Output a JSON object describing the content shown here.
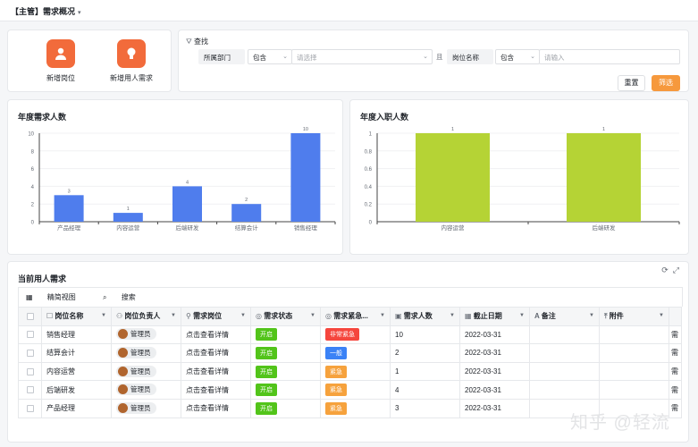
{
  "header": {
    "title": "【主管】需求概况",
    "caret": "▾"
  },
  "actions": [
    {
      "label": "新增岗位",
      "icon": "person-icon"
    },
    {
      "label": "新增用人需求",
      "icon": "lightbulb-icon"
    }
  ],
  "filter": {
    "title": "查找",
    "field1": "所属部门",
    "op1": "包含",
    "ph1": "请选择",
    "conj": "且",
    "field2": "岗位名称",
    "op2": "包含",
    "ph2": "请输入",
    "reset": "重置",
    "submit": "筛选"
  },
  "chart_data": [
    {
      "type": "bar",
      "title": "年度需求人数",
      "categories": [
        "产品经理",
        "内容运营",
        "后端研发",
        "结算会计",
        "销售经理"
      ],
      "values": [
        3,
        1,
        4,
        2,
        10
      ],
      "ylim": [
        0,
        10
      ],
      "yticks": [
        0,
        2,
        4,
        6,
        8,
        10
      ],
      "color": "#4f7ded"
    },
    {
      "type": "bar",
      "title": "年度入职人数",
      "categories": [
        "内容运营",
        "后端研发"
      ],
      "values": [
        1,
        1
      ],
      "ylim": [
        0,
        1
      ],
      "yticks": [
        "0",
        "0.2",
        "0.4",
        "0.6",
        "0.8",
        "1"
      ],
      "color": "#b5d335"
    }
  ],
  "table": {
    "title": "当前用人需求",
    "toolbar": {
      "view": "精简视图",
      "search": "搜索"
    },
    "columns": [
      "岗位名称",
      "岗位负责人",
      "需求岗位",
      "需求状态",
      "需求紧急...",
      "需求人数",
      "截止日期",
      "备注",
      "附件"
    ],
    "rows": [
      {
        "name": "销售经理",
        "owner": "管理员",
        "link": "点击查看详情",
        "status": "开启",
        "urgency": "非常紧急",
        "count": "10",
        "date": "2022-03-31"
      },
      {
        "name": "结算会计",
        "owner": "管理员",
        "link": "点击查看详情",
        "status": "开启",
        "urgency": "一般",
        "count": "2",
        "date": "2022-03-31"
      },
      {
        "name": "内容运营",
        "owner": "管理员",
        "link": "点击查看详情",
        "status": "开启",
        "urgency": "紧急",
        "count": "1",
        "date": "2022-03-31"
      },
      {
        "name": "后端研发",
        "owner": "管理员",
        "link": "点击查看详情",
        "status": "开启",
        "urgency": "紧急",
        "count": "4",
        "date": "2022-03-31"
      },
      {
        "name": "产品经理",
        "owner": "管理员",
        "link": "点击查看详情",
        "status": "开启",
        "urgency": "紧急",
        "count": "3",
        "date": "2022-03-31"
      }
    ],
    "overflow_col": "需"
  },
  "colors": {
    "status_open": "#52c41a",
    "urgent_very": "#f5463d",
    "urgent_normal": "#3b82f6",
    "urgent": "#f6a23d",
    "accent": "#f6993d"
  },
  "watermark": "知乎 @轻流"
}
